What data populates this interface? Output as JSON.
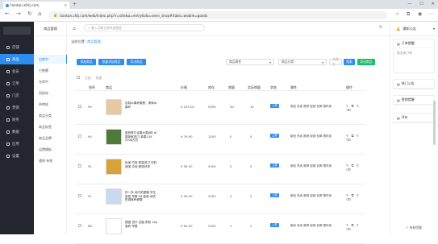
{
  "browser": {
    "tab_title": "tiantan.zhitj.com",
    "url": "tiantan.zhtj.com/web/index.php?r=site&a=entry&do=seen_shop#/tabs=wobile=goods"
  },
  "sidebar": {
    "items": [
      {
        "label": "店铺",
        "icon": "store-icon"
      },
      {
        "label": "商品",
        "icon": "goods-icon"
      },
      {
        "label": "会员",
        "icon": "member-icon"
      },
      {
        "label": "订单",
        "icon": "order-icon"
      },
      {
        "label": "门店",
        "icon": "shop-icon"
      },
      {
        "label": "营销",
        "icon": "marketing-icon"
      },
      {
        "label": "财务",
        "icon": "finance-icon"
      },
      {
        "label": "数据",
        "icon": "data-icon"
      },
      {
        "label": "应用",
        "icon": "app-icon"
      },
      {
        "label": "设置",
        "icon": "settings-icon"
      }
    ],
    "active_index": 1
  },
  "subnav": {
    "header": "商品管理",
    "items": [
      "出售中",
      "已售罄",
      "仓库中",
      "回收站",
      "待审核",
      "商品分类",
      "商品标签",
      "商品品牌",
      "运费模板",
      "通知 有效"
    ],
    "active_index": 0
  },
  "header": {
    "search_placeholder": "输入功能名称快速搜索"
  },
  "breadcrumb": {
    "prefix": "当前位置:",
    "current": "商品管理"
  },
  "toolbar": {
    "add_goods": "添加商品",
    "batch_edit": "批量添加商品",
    "export": "导出商品",
    "attribute_select": "商品属性",
    "category_select": "商品分类",
    "keyword_placeholder": "关键字",
    "search": "搜索",
    "export_btn": "导出商品"
  },
  "table": {
    "batch_labels": [
      "全选",
      "批量"
    ],
    "headers": [
      "排序",
      "商品",
      "价格",
      "库存",
      "销量",
      "实际销量",
      "状态",
      "属性",
      "操作"
    ],
    "rows": [
      {
        "sort": "95",
        "name": "自制水果杯套餐，美味水果杯",
        "price": "¥ 235.00",
        "stock": "9950",
        "sales": "50",
        "real_sales": "10",
        "status": "上架",
        "tags": "新品 热卖 推荐 促销 包邮 限时卖",
        "thumb_color": "#e8c7a4"
      },
      {
        "sort": "94",
        "name": "墨西哥牛油果大果6枚 水果新鲜进口 单果130-200g左右",
        "price": "¥ 79.90",
        "stock": "2000",
        "sales": "0",
        "real_sales": "0",
        "status": "上架",
        "tags": "新品 热卖 推荐 促销 包邮 限时卖",
        "thumb_color": "#4f7a39"
      },
      {
        "sort": "91",
        "name": "怡宝 巴西 原装进口 饮料速溶 冲泡 精选好茶",
        "price": "¥ 58.00",
        "stock": "4000",
        "sales": "0",
        "real_sales": "0",
        "status": "上架",
        "tags": "新品 热卖 推荐 促销 包邮 限时卖",
        "thumb_color": "#d8a23a"
      },
      {
        "sort": "91",
        "name": "好一多 纯牛奶整箱 学生 家庭 早餐 84 盒装 优质奶源营养健康",
        "price": "¥ 99.00",
        "stock": "2000",
        "sales": "0",
        "real_sales": "0",
        "status": "上架",
        "tags": "新品 热卖 推荐 促销 包邮 限时卖",
        "thumb_color": "#c9d9ee"
      },
      {
        "sort": "88",
        "name": "德国 进口 全脂 奶粉 1kg 营养 早餐",
        "price": "¥ 64.90",
        "stock": "2000",
        "sales": "2",
        "real_sales": "2",
        "status": "上架",
        "tags": "新品 热卖 推荐 促销 包邮 限时卖",
        "thumb_color": "#ffffff"
      }
    ]
  },
  "right_panel": {
    "header": "通知公告",
    "cards": [
      {
        "title": "订单提醒",
        "body": "暂无新订单"
      },
      {
        "title": "热门公告",
        "body": ""
      },
      {
        "title": "营销提醒",
        "body": ""
      },
      {
        "title": "评价",
        "body": ""
      }
    ],
    "footer": "+ 有新提醒"
  },
  "colors": {
    "sidebar_bg": "#23262e",
    "accent": "#2d8cf0",
    "success": "#19be6b"
  }
}
